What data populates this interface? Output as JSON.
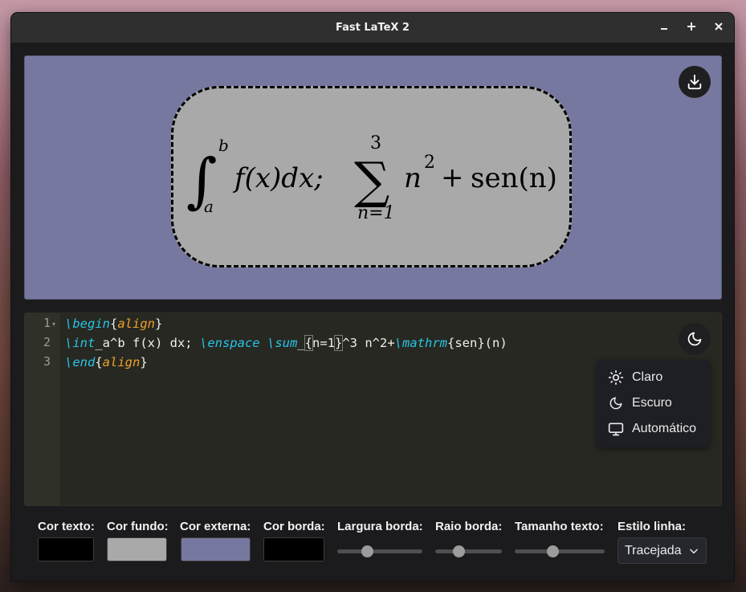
{
  "window": {
    "title": "Fast LaTeX 2",
    "minimize": "–",
    "maximize": "+",
    "close": "×"
  },
  "preview": {
    "background": "#76789f",
    "box_fill": "#a9a9a9",
    "border_color": "#000000",
    "formula_tex": "\\int_a^b f(x) dx; \\enspace \\sum_{n=1}^3 n^2+\\mathrm{sen}(n)",
    "rendered": {
      "integral_sign": "∫",
      "lower_limit": "a",
      "upper_limit": "b",
      "integrand": "f(x)dx;",
      "sum_sign": "∑",
      "sum_upper": "3",
      "sum_lower": "n=1",
      "term_base": "n",
      "term_exp": "2",
      "plus": "+",
      "func": "sen(n)"
    },
    "download_icon": "download-icon"
  },
  "editor": {
    "line_numbers": [
      "1",
      "2",
      "3"
    ],
    "lines": [
      {
        "kw": "\\begin",
        "open": "{",
        "arg": "align",
        "close": "}"
      },
      {
        "kw1": "\\int",
        "t1": "_a^b f(x) dx; ",
        "kw2": "\\enspace",
        "t2": " ",
        "kw3": "\\sum",
        "t3": "_",
        "b1": "{",
        "t4": "n=1",
        "b2": "}",
        "t5": "^3 n^2+",
        "kw4": "\\mathrm",
        "t6": "{sen}(n)"
      },
      {
        "kw": "\\end",
        "open": "{",
        "arg": "align",
        "close": "}"
      }
    ],
    "theme_icon": "moon-icon"
  },
  "theme_menu": {
    "items": [
      {
        "label": "Claro",
        "icon": "sun-icon"
      },
      {
        "label": "Escuro",
        "icon": "moon-icon"
      },
      {
        "label": "Automático",
        "icon": "monitor-icon"
      }
    ]
  },
  "controls": {
    "text_color": {
      "label": "Cor texto:",
      "value": "#000000"
    },
    "bg_color": {
      "label": "Cor fundo:",
      "value": "#a9a9a9"
    },
    "outer_color": {
      "label": "Cor externa:",
      "value": "#76789f"
    },
    "border_color": {
      "label": "Cor borda:",
      "value": "#000000"
    },
    "border_width": {
      "label": "Largura borda:",
      "fraction": 0.33
    },
    "border_radius": {
      "label": "Raio borda:",
      "fraction": 0.33
    },
    "text_size": {
      "label": "Tamanho texto:",
      "fraction": 0.41
    },
    "line_style": {
      "label": "Estilo linha:",
      "value": "Tracejada"
    }
  }
}
